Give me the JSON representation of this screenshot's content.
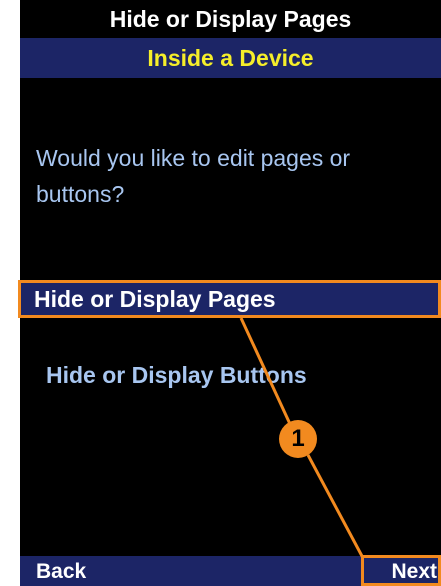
{
  "screen": {
    "title": "Hide or Display Pages",
    "subtitle": "Inside a Device",
    "prompt": "Would you like to edit pages or buttons?"
  },
  "options": [
    {
      "label": "Hide or Display Pages",
      "selected": true
    },
    {
      "label": "Hide or Display Buttons",
      "selected": false
    }
  ],
  "softkeys": {
    "left": "Back",
    "right": "Next"
  },
  "annotation": {
    "callout_number": "1",
    "color": "#f28a1f"
  },
  "colors": {
    "background": "#000000",
    "bar": "#1c2566",
    "subtitle_text": "#f5ee2a",
    "body_text": "#a8c6f0"
  }
}
